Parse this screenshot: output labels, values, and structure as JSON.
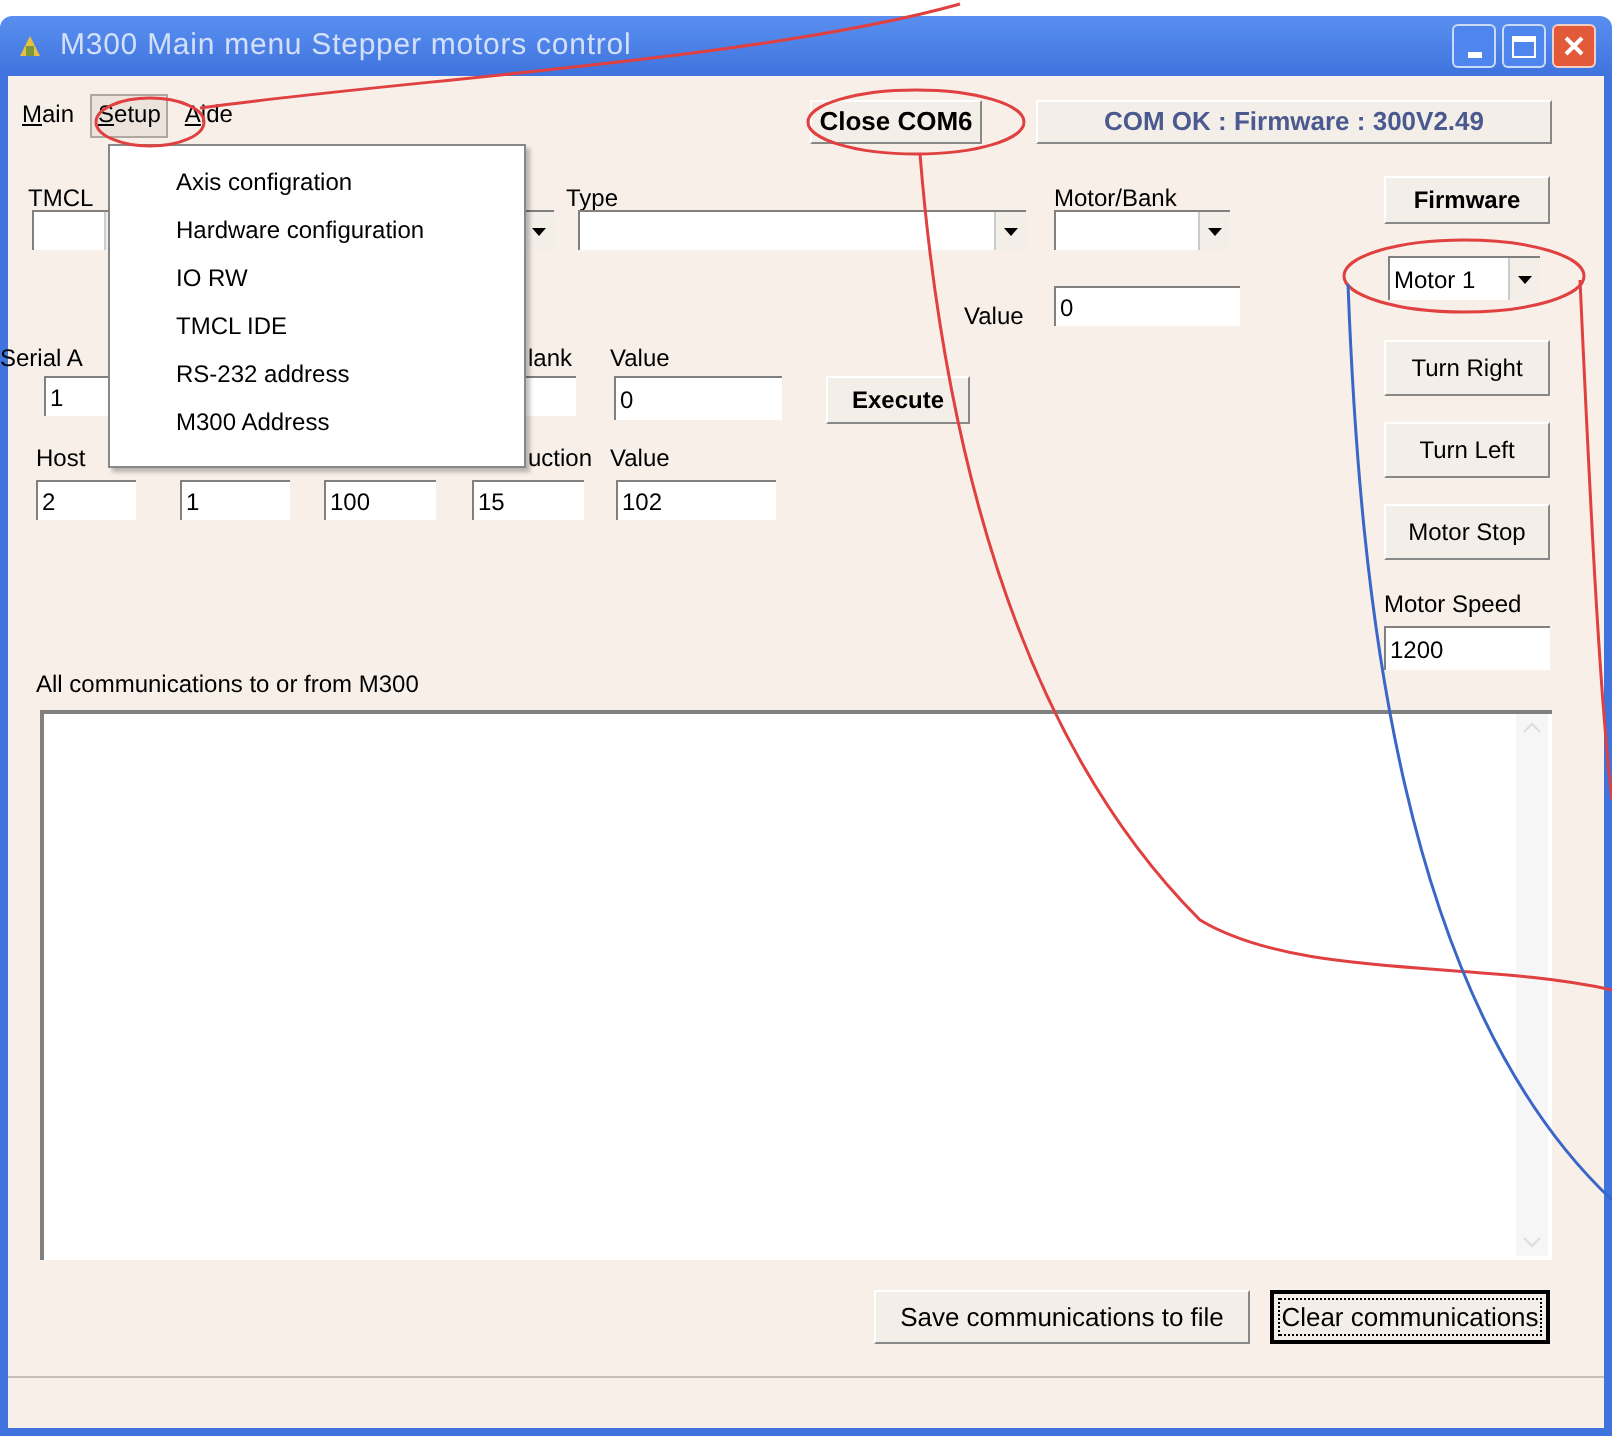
{
  "window": {
    "title": "M300 Main menu  Stepper motors control"
  },
  "menu_bar": [
    {
      "label": "Main",
      "selected": false
    },
    {
      "label": "Setup",
      "selected": true
    },
    {
      "label": "Aide",
      "selected": false
    }
  ],
  "setup_menu": {
    "items": [
      "Axis configration",
      "Hardware configuration",
      "IO RW",
      "TMCL IDE",
      "RS-232 address",
      "M300 Address"
    ]
  },
  "connection": {
    "close_button": "Close COM6",
    "status_button": "COM OK : Firmware : 300V2.49"
  },
  "labels": [
    "TMCL",
    "Type",
    "Motor/Bank",
    "Value",
    "Serial A",
    "lank",
    "Value",
    "Host",
    "uction",
    "Value",
    "Motor Speed",
    "All communications to or from M300"
  ],
  "inputs": [
    {
      "kind": "combo"
    },
    {
      "kind": "combo"
    },
    {
      "kind": "combo"
    },
    {
      "kind": "combo"
    },
    {
      "kind": "combo",
      "value": "Motor 1"
    },
    {
      "kind": "text",
      "value": "0"
    },
    {
      "kind": "text",
      "value": "1"
    },
    {
      "kind": "text"
    },
    {
      "kind": "text",
      "value": "0"
    },
    {
      "kind": "text",
      "value": "2"
    },
    {
      "kind": "text",
      "value": "1"
    },
    {
      "kind": "text",
      "value": "100"
    },
    {
      "kind": "text",
      "value": "15"
    },
    {
      "kind": "text",
      "value": "102"
    },
    {
      "kind": "text",
      "value": "1200"
    }
  ],
  "buttons": [
    {
      "label": "Firmware",
      "focused": false
    },
    {
      "label": "Execute",
      "focused": false
    },
    {
      "label": "Turn Right",
      "focused": false
    },
    {
      "label": "Turn Left",
      "focused": false
    },
    {
      "label": "Motor Stop",
      "focused": false
    },
    {
      "label": "Save communications to file",
      "focused": false
    },
    {
      "label": "Clear communications",
      "focused": true
    }
  ],
  "log": {
    "kind": "empty"
  }
}
